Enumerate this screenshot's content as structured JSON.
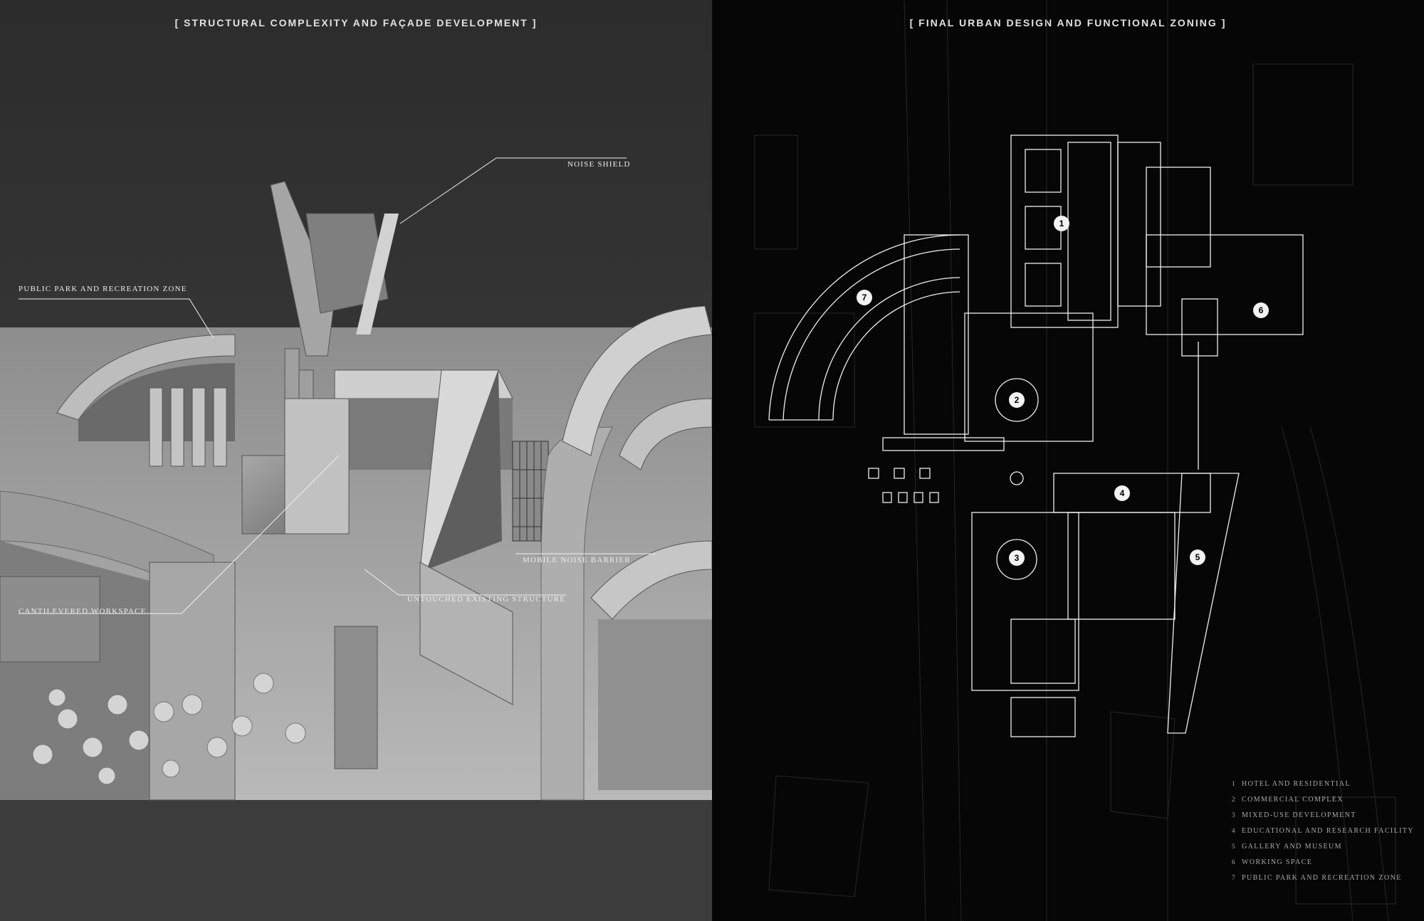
{
  "left_panel": {
    "title": "[ STRUCTURAL COMPLEXITY AND FAÇADE DEVELOPMENT ]",
    "callouts": {
      "noise_shield": "NOISE SHIELD",
      "public_park": "PUBLIC PARK AND RECREATION ZONE",
      "mobile_noise_barrier": "MOBILE NOISE BARRIER",
      "untouched_structure": "UNTOUCHED EXISTING STRUCTURE",
      "cantilevered_workspace": "CANTILEVERED WORKSPACE"
    }
  },
  "right_panel": {
    "title": "[ FINAL URBAN DESIGN AND FUNCTIONAL ZONING ]",
    "zone_markers": [
      "1",
      "2",
      "3",
      "4",
      "5",
      "6",
      "7"
    ],
    "legend": [
      {
        "num": "1",
        "label": "HOTEL AND RESIDENTIAL"
      },
      {
        "num": "2",
        "label": "COMMERCIAL COMPLEX"
      },
      {
        "num": "3",
        "label": "MIXED-USE DEVELOPMENT"
      },
      {
        "num": "4",
        "label": "EDUCATIONAL AND RESEARCH FACILITY"
      },
      {
        "num": "5",
        "label": "GALLERY AND MUSEUM"
      },
      {
        "num": "6",
        "label": "WORKING SPACE"
      },
      {
        "num": "7",
        "label": "PUBLIC PARK AND RECREATION ZONE"
      }
    ]
  },
  "colors": {
    "left_bg": "#3a3a3a",
    "right_bg": "#060606",
    "line": "#f0f0f0",
    "legend_text": "#a9a9a9"
  }
}
